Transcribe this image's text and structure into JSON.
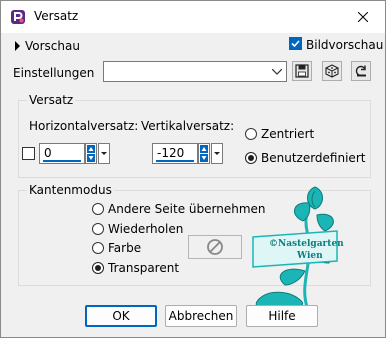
{
  "window": {
    "title": "Versatz"
  },
  "preview": {
    "toggle_label": "Vorschau",
    "image_preview_label": "Bildvorschau",
    "image_preview_checked": true
  },
  "settings": {
    "label": "Einstellungen",
    "value": ""
  },
  "offset_group": {
    "title": "Versatz",
    "horizontal_label": "Horizontalversatz:",
    "horizontal_value": "0",
    "vertical_label": "Vertikalversatz:",
    "vertical_value": "-120",
    "centered_label": "Zentriert",
    "custom_label": "Benutzerdefiniert",
    "selected": "custom"
  },
  "edge_group": {
    "title": "Kantenmodus",
    "options": [
      "Andere Seite übernehmen",
      "Wiederholen",
      "Farbe",
      "Transparent"
    ],
    "selected": "Transparent"
  },
  "watermark": {
    "line1": "©Nastelgarten",
    "line2": "Wien"
  },
  "buttons": {
    "ok": "OK",
    "cancel": "Abbrechen",
    "help": "Hilfe"
  },
  "colors": {
    "accent": "#0067c0",
    "watermark": "#1bb5b5"
  }
}
